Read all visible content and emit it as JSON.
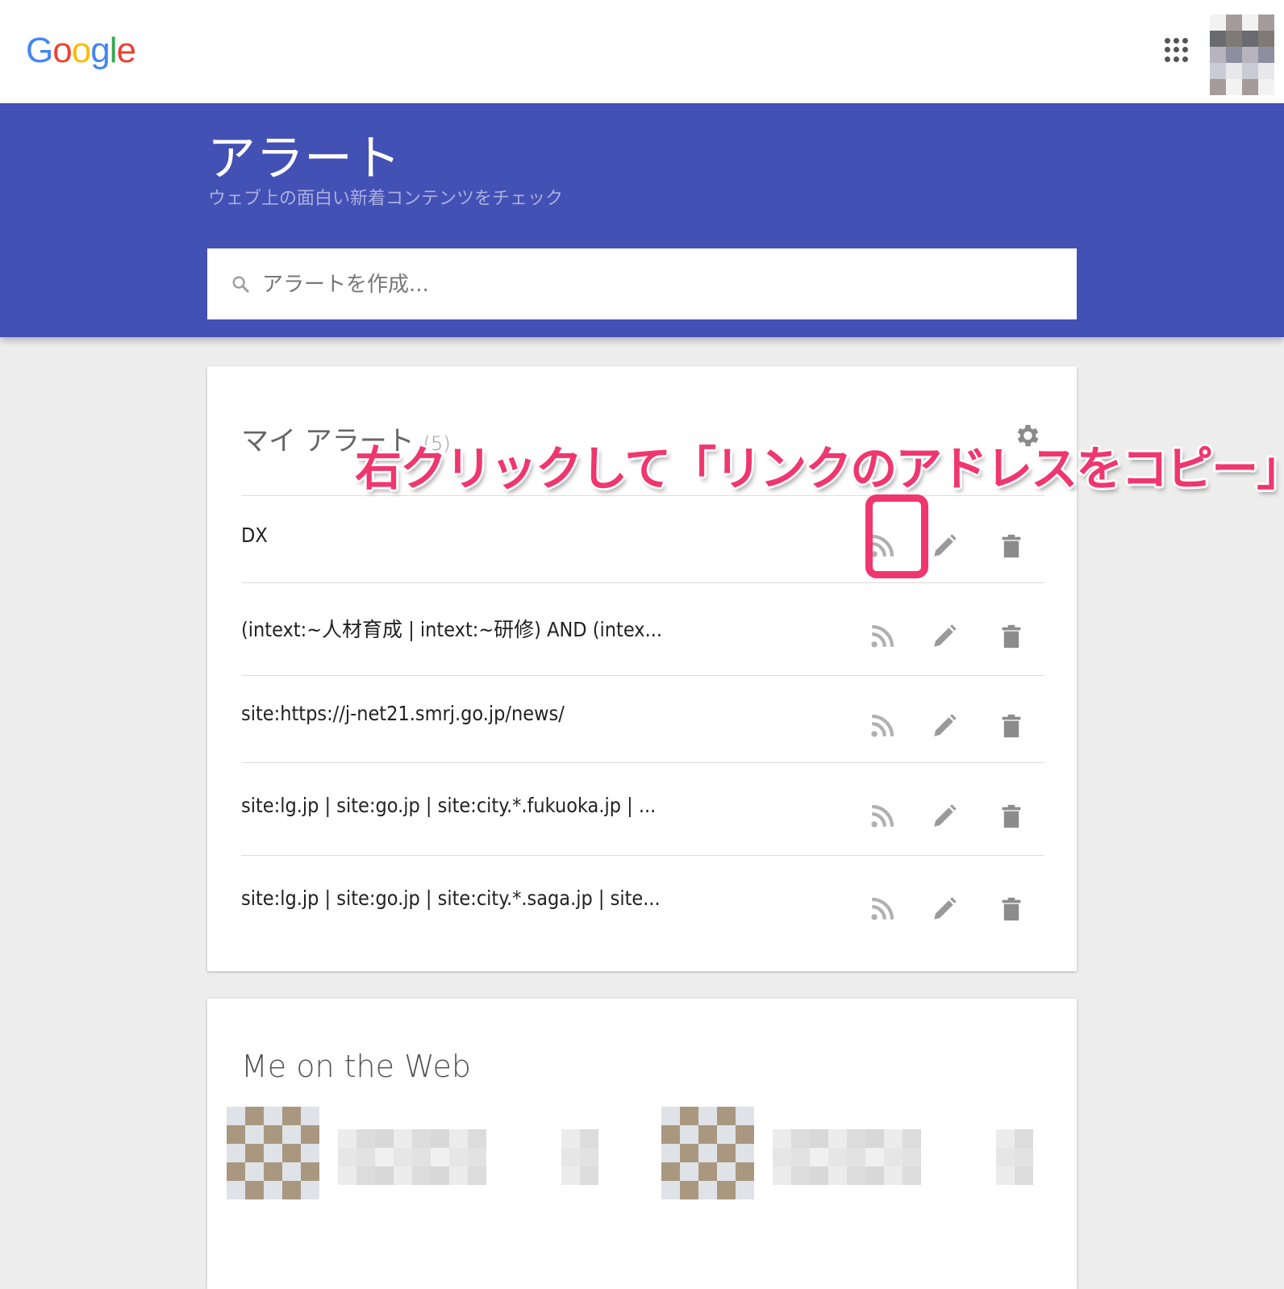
{
  "header": {
    "logo_letters": [
      {
        "ch": "G",
        "color": "#4285f4"
      },
      {
        "ch": "o",
        "color": "#ea4335"
      },
      {
        "ch": "o",
        "color": "#fbbc05"
      },
      {
        "ch": "g",
        "color": "#4285f4"
      },
      {
        "ch": "l",
        "color": "#34a853"
      },
      {
        "ch": "e",
        "color": "#ea4335"
      }
    ],
    "apps_icon": "grid-9-dots",
    "account_avatar": "pixelated-avatar"
  },
  "hero": {
    "title": "アラート",
    "subtitle": "ウェブ上の面白い新着コンテンツをチェック",
    "background_color": "#4350b4"
  },
  "search": {
    "placeholder": "アラートを作成...",
    "value": "",
    "icon": "search-icon"
  },
  "my_alerts": {
    "heading": "マイ アラート",
    "count": "(5)",
    "settings_icon": "gear-icon",
    "alerts": [
      {
        "label": "DX"
      },
      {
        "label": "(intext:~人材育成 | intext:~研修) AND (intex..."
      },
      {
        "label": "site:https://j-net21.smrj.go.jp/news/"
      },
      {
        "label": "site:lg.jp | site:go.jp | site:city.*.fukuoka.jp | ..."
      },
      {
        "label": "site:lg.jp | site:go.jp | site:city.*.saga.jp | site..."
      }
    ],
    "row_actions": [
      "rss-feed-icon",
      "edit-pencil-icon",
      "delete-trash-icon"
    ]
  },
  "me_on_web": {
    "heading": "Me on the Web"
  },
  "annotation": {
    "text": "右クリックして「リンクのアドレスをコピー」",
    "color": "#f0366f"
  }
}
